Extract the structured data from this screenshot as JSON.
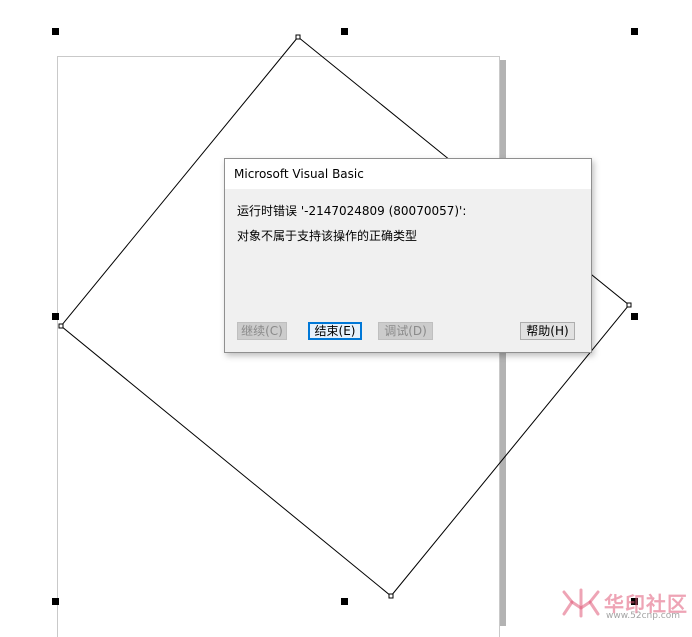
{
  "dialog": {
    "title": "Microsoft Visual Basic",
    "message_line1": "运行时错误 '-2147024809 (80070057)':",
    "message_line2": "对象不属于支持该操作的正确类型",
    "buttons": {
      "continue": "继续(C)",
      "end": "结束(E)",
      "debug": "调试(D)",
      "help": "帮助(H)"
    }
  },
  "watermark": {
    "text": "华印社区",
    "url": "www.52cnp.com"
  },
  "colors": {
    "focus_border": "#0078d7",
    "dialog_bg": "#f0f0f0",
    "watermark": "#e05a78"
  }
}
